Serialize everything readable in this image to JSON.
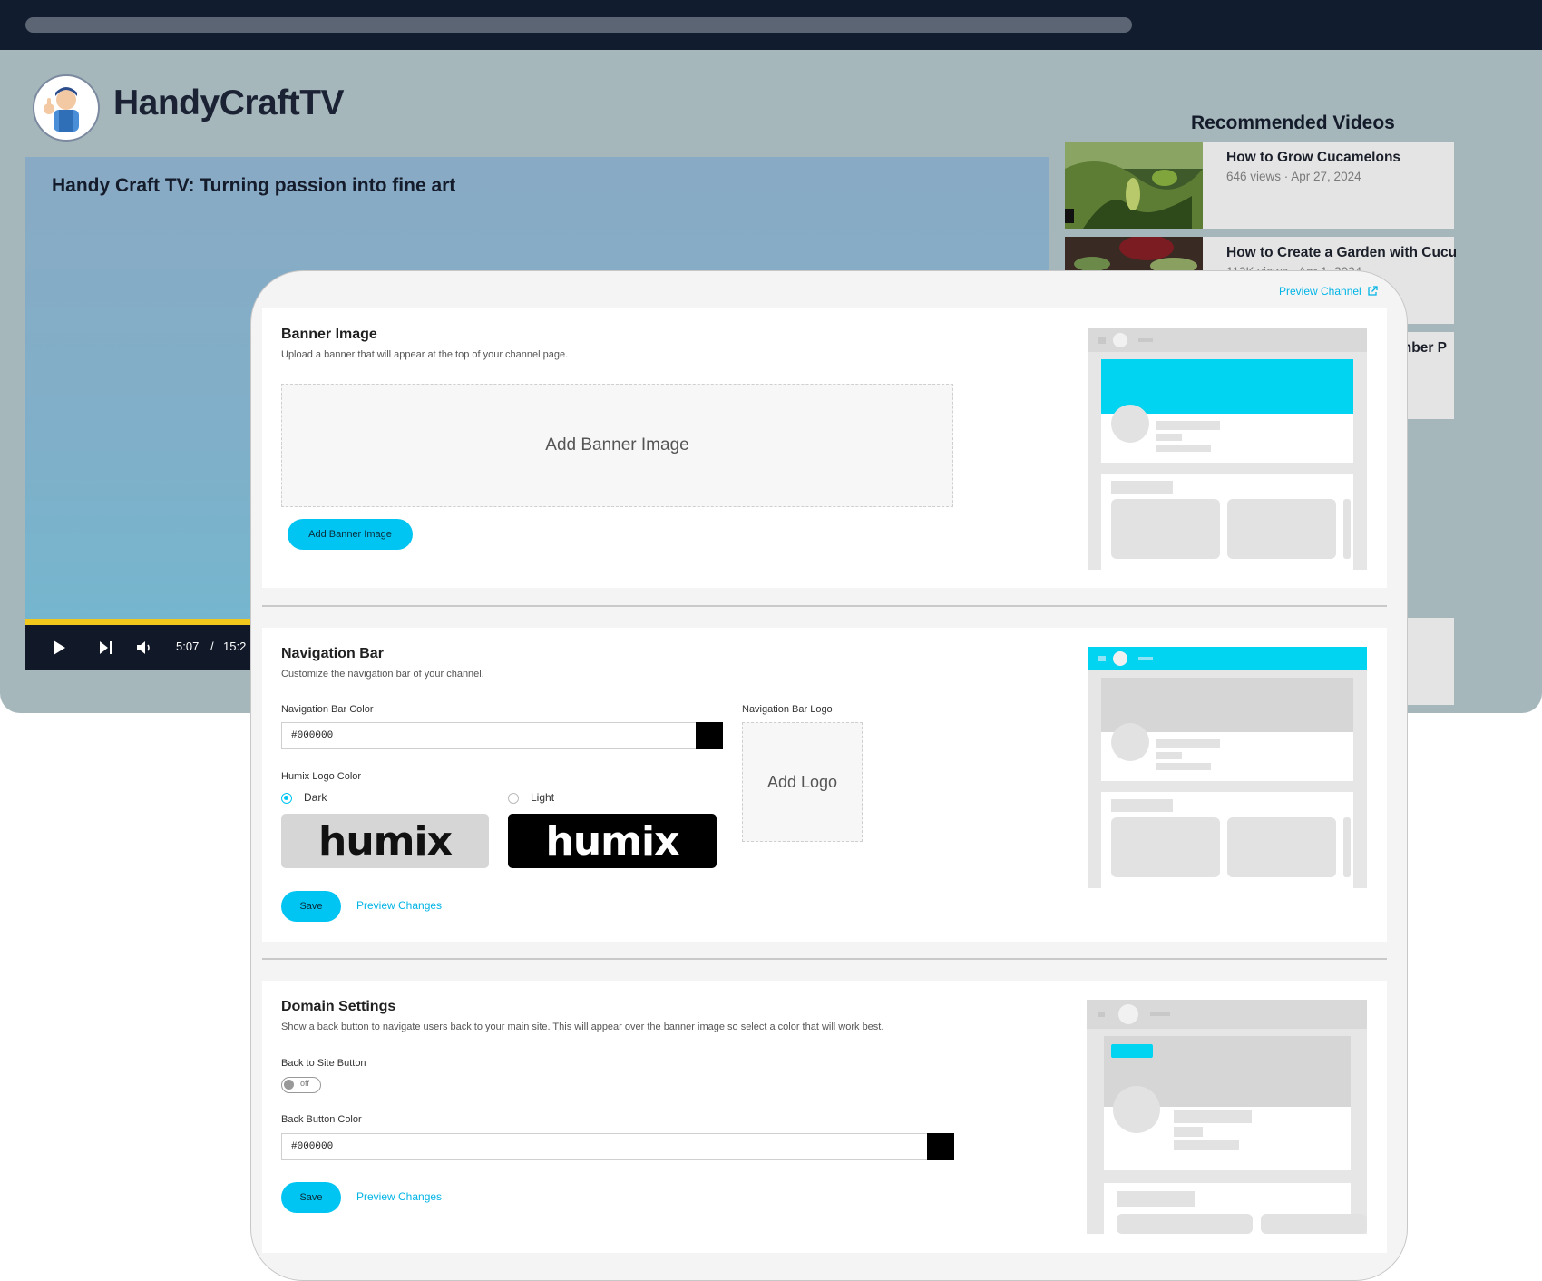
{
  "channel": {
    "name": "HandyCraftTV",
    "video_title": "Handy Craft TV: Turning passion into fine art",
    "time_current": "5:07",
    "time_separator": "/",
    "time_total": "15:2",
    "recommended_heading": "Recommended Videos",
    "recommended": [
      {
        "title": "How to Grow Cucamelons",
        "meta": "646 views · Apr 27, 2024"
      },
      {
        "title": "How to Create a Garden with Cucu",
        "meta": "113K views · Apr 1, 2024"
      },
      {
        "title": "nber P",
        "meta": ""
      }
    ]
  },
  "panel": {
    "preview_channel": "Preview Channel",
    "banner": {
      "title": "Banner Image",
      "description": "Upload a banner that will appear at the top of your channel page.",
      "dropzone_label": "Add Banner Image",
      "button_label": "Add Banner Image"
    },
    "navbar": {
      "title": "Navigation Bar",
      "description": "Customize the navigation bar of your channel.",
      "color_label": "Navigation Bar Color",
      "color_value": "#000000",
      "logo_label": "Navigation Bar Logo",
      "add_logo": "Add Logo",
      "humix_color_label": "Humix Logo Color",
      "option_dark": "Dark",
      "option_light": "Light",
      "selected": "Dark",
      "logo_text": "humix",
      "save": "Save",
      "preview_changes": "Preview Changes"
    },
    "domain": {
      "title": "Domain Settings",
      "description": "Show a back button to navigate users back to your main site. This will appear over the banner image so select a color that will work best.",
      "back_button_label": "Back to Site Button",
      "toggle_state": "off",
      "back_color_label": "Back Button Color",
      "back_color_value": "#000000",
      "save": "Save",
      "preview_changes": "Preview Changes"
    }
  },
  "colors": {
    "accent": "#00c5f2",
    "topbar": "#111c2e",
    "page_bg": "#a6b7bb",
    "swatch": "#000000"
  }
}
